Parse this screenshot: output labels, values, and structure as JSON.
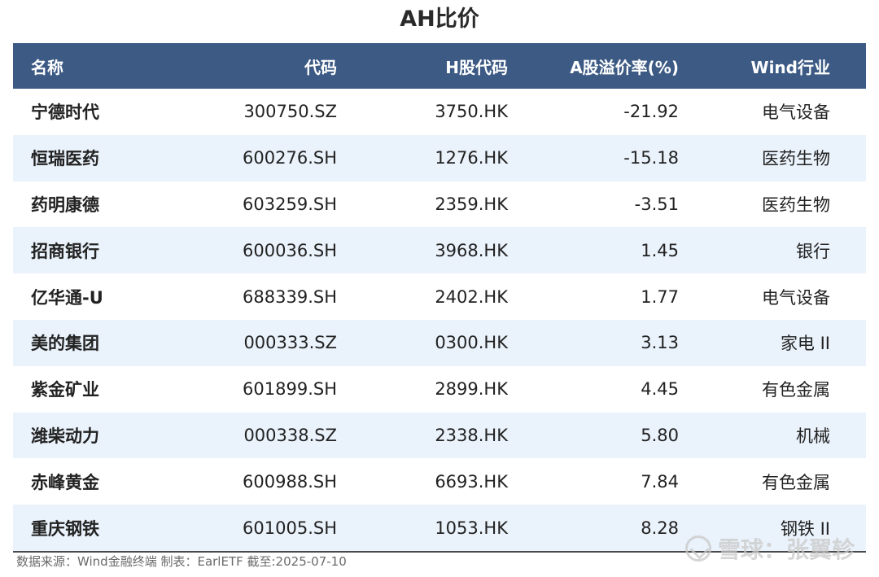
{
  "title": "AH比价",
  "headers": {
    "name": "名称",
    "code": "代码",
    "hcode": "H股代码",
    "premium": "A股溢价率(%)",
    "industry": "Wind行业"
  },
  "rows": [
    {
      "name": "宁德时代",
      "code": "300750.SZ",
      "hcode": "3750.HK",
      "premium": "-21.92",
      "industry": "电气设备"
    },
    {
      "name": "恒瑞医药",
      "code": "600276.SH",
      "hcode": "1276.HK",
      "premium": "-15.18",
      "industry": "医药生物"
    },
    {
      "name": "药明康德",
      "code": "603259.SH",
      "hcode": "2359.HK",
      "premium": "-3.51",
      "industry": "医药生物"
    },
    {
      "name": "招商银行",
      "code": "600036.SH",
      "hcode": "3968.HK",
      "premium": "1.45",
      "industry": "银行"
    },
    {
      "name": "亿华通-U",
      "code": "688339.SH",
      "hcode": "2402.HK",
      "premium": "1.77",
      "industry": "电气设备"
    },
    {
      "name": "美的集团",
      "code": "000333.SZ",
      "hcode": "0300.HK",
      "premium": "3.13",
      "industry": "家电 II"
    },
    {
      "name": "紫金矿业",
      "code": "601899.SH",
      "hcode": "2899.HK",
      "premium": "4.45",
      "industry": "有色金属"
    },
    {
      "name": "潍柴动力",
      "code": "000338.SZ",
      "hcode": "2338.HK",
      "premium": "5.80",
      "industry": "机械"
    },
    {
      "name": "赤峰黄金",
      "code": "600988.SH",
      "hcode": "6693.HK",
      "premium": "7.84",
      "industry": "有色金属"
    },
    {
      "name": "重庆钢铁",
      "code": "601005.SH",
      "hcode": "1053.HK",
      "premium": "8.28",
      "industry": "钢铁 II"
    }
  ],
  "source": "数据来源：Wind金融终端 制表：EarlETF 截至:2025-07-10",
  "watermark": "雪球：张翼轸",
  "colors": {
    "header_bg": "#3c5a84",
    "stripe": "#eaf2fb"
  }
}
